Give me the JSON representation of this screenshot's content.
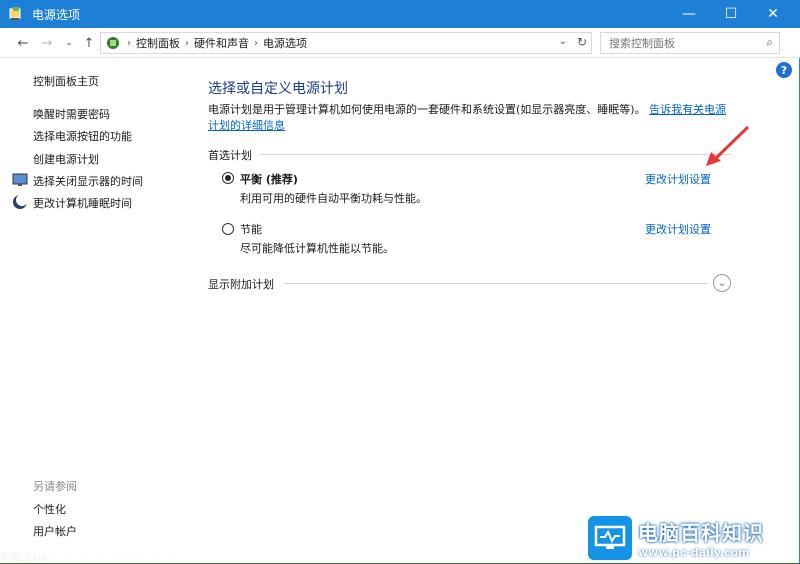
{
  "window": {
    "title": "电源选项",
    "minimize": "—",
    "maximize": "☐",
    "close": "✕"
  },
  "address": {
    "crumbs": [
      "控制面板",
      "硬件和声音",
      "电源选项"
    ],
    "search_placeholder": "搜索控制面板"
  },
  "sidebar": {
    "home": "控制面板主页",
    "items": [
      {
        "label": "唤醒时需要密码"
      },
      {
        "label": "选择电源按钮的功能"
      },
      {
        "label": "创建电源计划"
      },
      {
        "label": "选择关闭显示器的时间"
      },
      {
        "label": "更改计算机睡眠时间"
      }
    ],
    "see_also_title": "另请参阅",
    "see_also": [
      "个性化",
      "用户帐户"
    ]
  },
  "main": {
    "heading": "选择或自定义电源计划",
    "description": "电源计划是用于管理计算机如何使用电源的一套硬件和系统设置(如显示器亮度、睡眠等)。",
    "description_link": "告诉我有关电源计划的详细信息",
    "preferred_title": "首选计划",
    "plans": [
      {
        "name": "平衡 (推荐)",
        "desc": "利用可用的硬件自动平衡功耗与性能。",
        "change": "更改计划设置",
        "selected": true
      },
      {
        "name": "节能",
        "desc": "尽可能降低计算机性能以节能。",
        "change": "更改计划设置",
        "selected": false
      }
    ],
    "extra_title": "显示附加计划"
  },
  "taskbar_text": "护窗口.txt·  ·  ·  ·  ·  ·  ·  ·  ·  ·  ·  ·  ·  ·  ·  ·  ·  ·  ·  ·",
  "watermark": {
    "cn": "电脑百科知识",
    "en": "www.pc-daily.com"
  },
  "colors": {
    "accent": "#1e7fd6",
    "link": "#0066cc",
    "arrow": "#e53935"
  }
}
